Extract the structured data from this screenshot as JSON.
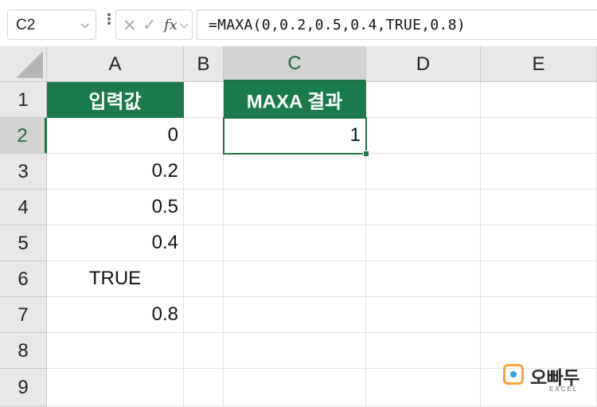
{
  "formula_bar": {
    "name_box": "C2",
    "cancel_icon": "✕",
    "enter_icon": "✓",
    "fx_label": "fx",
    "formula": "=MAXA(0,0.2,0.5,0.4,TRUE,0.8)"
  },
  "grid": {
    "columns": [
      "A",
      "B",
      "C",
      "D",
      "E"
    ],
    "rows": [
      "1",
      "2",
      "3",
      "4",
      "5",
      "6",
      "7",
      "8",
      "9"
    ],
    "selected_cell": "C2",
    "cells": {
      "A1": "입력값",
      "A2": "0",
      "A3": "0.2",
      "A4": "0.5",
      "A5": "0.4",
      "A6": "TRUE",
      "A7": "0.8",
      "C1": "MAXA 결과",
      "C2": "1"
    },
    "header_fill_color": "#1a7a4c",
    "selection_color": "#217346"
  },
  "watermark": {
    "brand": "오빠두",
    "sub": "EXCEL"
  }
}
